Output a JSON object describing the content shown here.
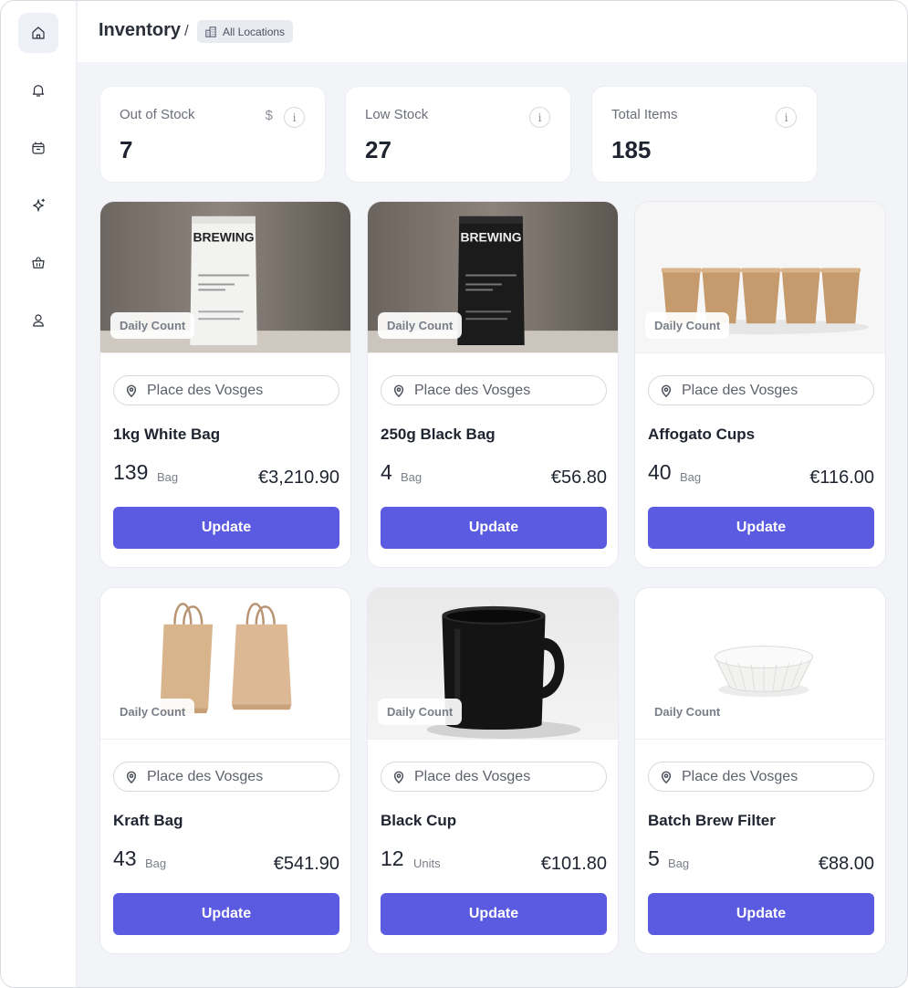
{
  "header": {
    "title": "Inventory",
    "separator": "/",
    "location_chip": "All Locations"
  },
  "sidebar": {
    "items": [
      {
        "icon": "home-icon",
        "active": true
      },
      {
        "icon": "bell-icon",
        "active": false
      },
      {
        "icon": "box-icon",
        "active": false
      },
      {
        "icon": "sparkle-icon",
        "active": false
      },
      {
        "icon": "basket-icon",
        "active": false
      },
      {
        "icon": "user-icon",
        "active": false
      }
    ]
  },
  "stats": [
    {
      "label": "Out of Stock",
      "value": "7",
      "extra_icon": "$",
      "info_icon": "i"
    },
    {
      "label": "Low Stock",
      "value": "27",
      "info_icon": "i"
    },
    {
      "label": "Total Items",
      "value": "185",
      "info_icon": "i"
    }
  ],
  "products": [
    {
      "badge": "Daily Count",
      "location": "Place des Vosges",
      "name": "1kg White Bag",
      "qty": "139",
      "unit": "Bag",
      "price": "€3,210.90",
      "update_label": "Update",
      "image": "white-coffee-bag"
    },
    {
      "badge": "Daily Count",
      "location": "Place des Vosges",
      "name": "250g Black Bag",
      "qty": "4",
      "unit": "Bag",
      "price": "€56.80",
      "update_label": "Update",
      "image": "black-coffee-bag"
    },
    {
      "badge": "Daily Count",
      "location": "Place des Vosges",
      "name": "Affogato Cups",
      "qty": "40",
      "unit": "Bag",
      "price": "€116.00",
      "update_label": "Update",
      "image": "paper-cups"
    },
    {
      "badge": "Daily Count",
      "location": "Place des Vosges",
      "name": "Kraft Bag",
      "qty": "43",
      "unit": "Bag",
      "price": "€541.90",
      "update_label": "Update",
      "image": "kraft-bags"
    },
    {
      "badge": "Daily Count",
      "location": "Place des Vosges",
      "name": "Black Cup",
      "qty": "12",
      "unit": "Units",
      "price": "€101.80",
      "update_label": "Update",
      "image": "black-mug"
    },
    {
      "badge": "Daily Count",
      "location": "Place des Vosges",
      "name": "Batch Brew Filter",
      "qty": "5",
      "unit": "Bag",
      "price": "€88.00",
      "update_label": "Update",
      "image": "coffee-filter"
    }
  ],
  "product_images": {
    "brand_text": "BREWING"
  },
  "colors": {
    "accent": "#5b5be1",
    "background": "#f3f4f8"
  }
}
